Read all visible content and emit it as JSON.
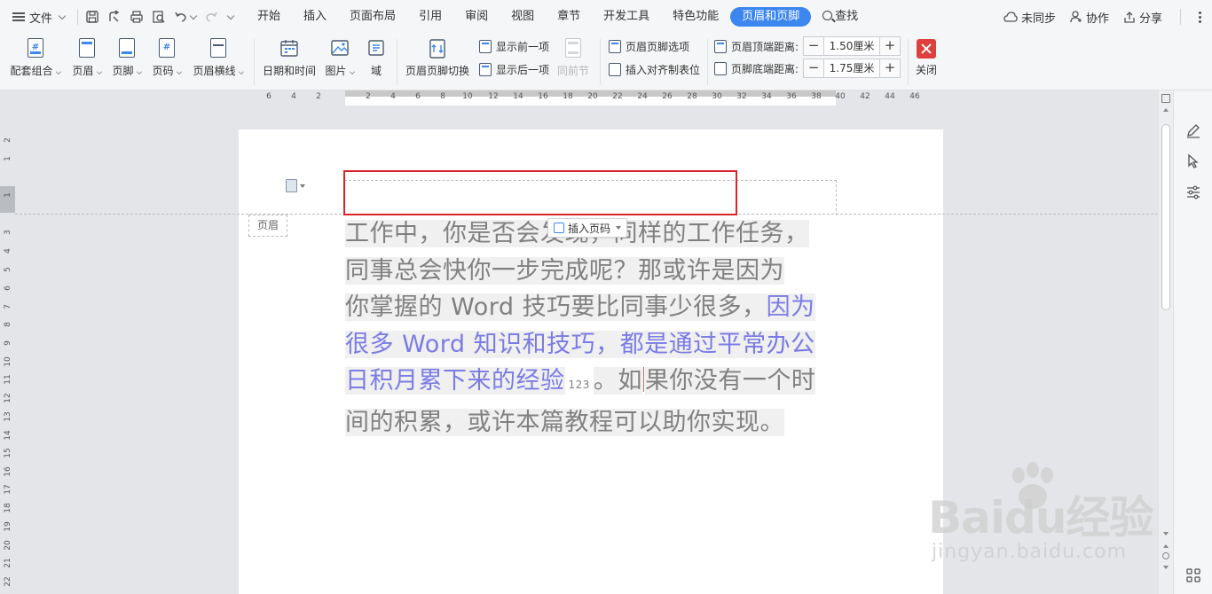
{
  "menubar": {
    "file_label": "文件",
    "tabs": [
      "开始",
      "插入",
      "页面布局",
      "引用",
      "审阅",
      "视图",
      "章节",
      "开发工具",
      "特色功能",
      "页眉和页脚"
    ],
    "search_label": "查找",
    "sync_label": "未同步",
    "collab_label": "协作",
    "share_label": "分享"
  },
  "ribbon": {
    "combo": "配套组合",
    "header": "页眉",
    "footer": "页脚",
    "page_num": "页码",
    "header_line": "页眉横线",
    "date_time": "日期和时间",
    "picture": "图片",
    "field": "域",
    "switch": "页眉页脚切换",
    "show_prev": "显示前一项",
    "show_next": "显示后一项",
    "same_prev": "同前节",
    "hf_options": "页眉页脚选项",
    "insert_align_tab": "插入对齐制表位",
    "header_top_dist_label": "页眉顶端距离:",
    "header_top_dist_value": "1.50厘米",
    "footer_bottom_dist_label": "页脚底端距离:",
    "footer_bottom_dist_value": "1.75厘米",
    "close": "关闭"
  },
  "ruler": {
    "h_ticks": [
      "6",
      "4",
      "2",
      "2",
      "4",
      "6",
      "8",
      "10",
      "12",
      "14",
      "16",
      "18",
      "20",
      "22",
      "24",
      "26",
      "28",
      "30",
      "32",
      "34",
      "36",
      "38",
      "40",
      "42",
      "44",
      "46"
    ],
    "v_ticks": [
      "2",
      "1",
      "1",
      "3",
      "4",
      "5",
      "6",
      "7",
      "8",
      "9",
      "10",
      "11",
      "12",
      "13",
      "14",
      "15",
      "16",
      "17",
      "18",
      "19",
      "20",
      "21",
      "22"
    ]
  },
  "document": {
    "header_tag": "页眉",
    "insert_page_number": "插入页码",
    "para_line1": "工作中，你是否会发现，同样的工作任务，",
    "para_line2": "同事总会快你一步完成呢？那或许是因为",
    "para_line3a": "你掌握的 Word 技巧要比同事少很多，",
    "para_line3b": "因为",
    "para_line4": "很多 Word 知识和技巧，都是通过平常办公",
    "para_line5a": "日积月累下来的经验",
    "para_small_num": "123",
    "para_line5b": "。如",
    "para_line5c": "果你没有一个时",
    "para_line6": "间的积累，或许本篇教程可以助你实现。"
  },
  "watermark": {
    "brand": "Baidu经验",
    "url": "jingyan.baidu.com"
  },
  "colors": {
    "accent": "#3c86f0",
    "highlight_box": "#d7262b",
    "link_text": "#7b7be6",
    "close": "#e0403d"
  }
}
